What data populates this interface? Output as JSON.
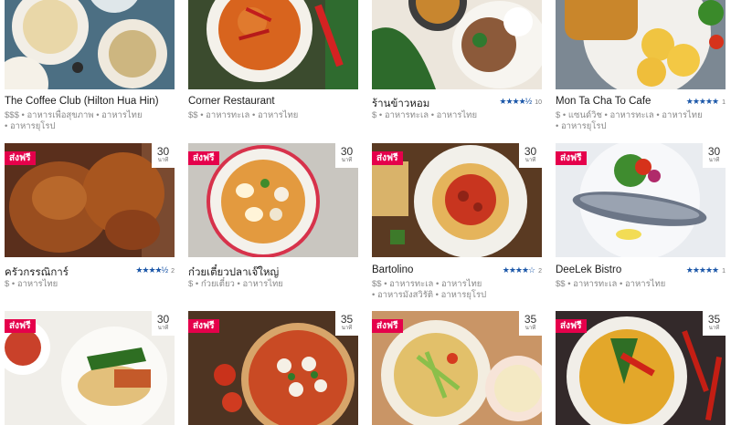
{
  "cards": [
    {
      "name": "The Coffee Club (Hilton Hua Hin)",
      "line1": "$$$ • อาหารเพื่อสุขภาพ • อาหารไทย",
      "line2": "• อาหารยุโรป",
      "stars": "",
      "count": ""
    },
    {
      "name": "Corner Restaurant",
      "line1": "$$ • อาหารทะเล • อาหารไทย",
      "line2": "",
      "stars": "",
      "count": ""
    },
    {
      "name": "ร้านข้าวหอม",
      "line1": "$ • อาหารทะเล • อาหารไทย",
      "line2": "",
      "stars": "★★★★½",
      "count": "10"
    },
    {
      "name": "Mon Ta Cha To Cafe",
      "line1": "$ • แซนด์วิช • อาหารทะเล • อาหารไทย",
      "line2": "• อาหารยุโรป",
      "stars": "★★★★★",
      "count": "1"
    },
    {
      "name": "ครัวกรรณิการ์",
      "line1": "$ • อาหารไทย",
      "line2": "",
      "stars": "★★★★½",
      "count": "2",
      "badge": "ส่งฟรี",
      "time": "30",
      "unit": "นาที"
    },
    {
      "name": "ก๋วยเตี๋ยวปลาเจ๊ใหญ่",
      "line1": "$ • ก๋วยเตี๋ยว • อาหารไทย",
      "line2": "",
      "stars": "",
      "count": "",
      "badge": "ส่งฟรี",
      "time": "30",
      "unit": "นาที"
    },
    {
      "name": "Bartolino",
      "line1": "$$ • อาหารทะเล • อาหารไทย",
      "line2": "• อาหารมังสวิรัติ • อาหารยุโรป",
      "stars": "★★★★☆",
      "count": "2",
      "badge": "ส่งฟรี",
      "time": "30",
      "unit": "นาที"
    },
    {
      "name": "DeeLek Bistro",
      "line1": "$$ • อาหารทะเล • อาหารไทย",
      "line2": "",
      "stars": "★★★★★",
      "count": "1",
      "badge": "ส่งฟรี",
      "time": "30",
      "unit": "นาที"
    },
    {
      "badge": "ส่งฟรี",
      "time": "30",
      "unit": "นาที"
    },
    {
      "badge": "ส่งฟรี",
      "time": "35",
      "unit": "นาที"
    },
    {
      "badge": "ส่งฟรี",
      "time": "35",
      "unit": "นาที"
    },
    {
      "badge": "ส่งฟรี",
      "time": "35",
      "unit": "นาที"
    }
  ]
}
